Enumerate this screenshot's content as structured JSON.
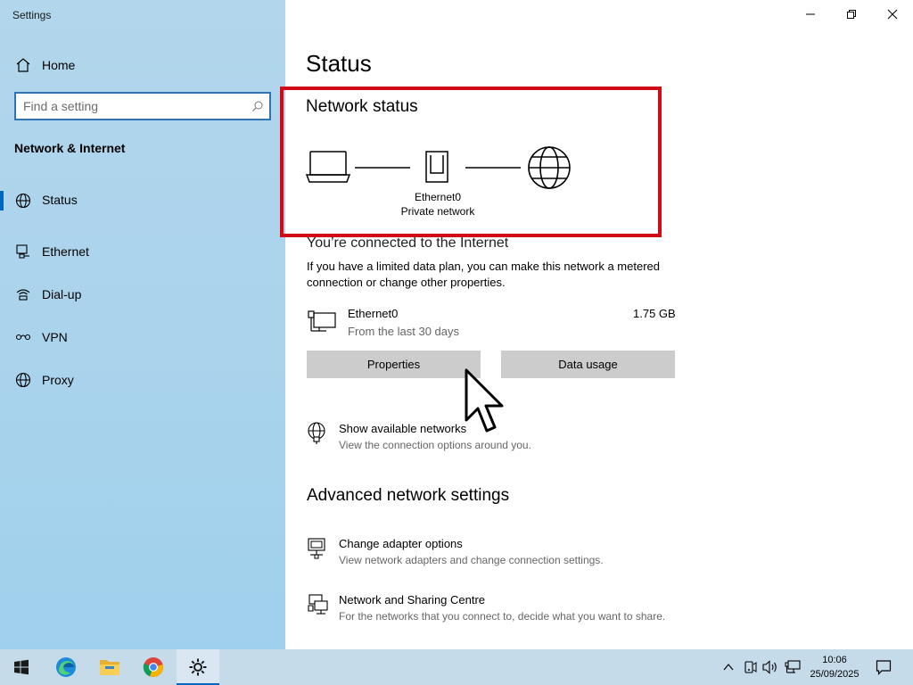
{
  "window": {
    "title": "Settings"
  },
  "sidebar": {
    "home_label": "Home",
    "search_placeholder": "Find a setting",
    "section_title": "Network & Internet",
    "items": [
      {
        "label": "Status",
        "icon": "globe-icon",
        "active": true
      },
      {
        "label": "Ethernet",
        "icon": "ethernet-icon"
      },
      {
        "label": "Dial-up",
        "icon": "dialup-icon"
      },
      {
        "label": "VPN",
        "icon": "vpn-icon"
      },
      {
        "label": "Proxy",
        "icon": "proxy-globe-icon"
      }
    ]
  },
  "main": {
    "title": "Status",
    "network_status": {
      "title": "Network status",
      "adapter_name": "Ethernet0",
      "network_type": "Private network",
      "highlight_color": "#d10a17"
    },
    "connection": {
      "title": "You’re connected to the Internet",
      "description": "If you have a limited data plan, you can make this network a metered connection or change other properties.",
      "adapter": "Ethernet0",
      "period": "From the last 30 days",
      "usage": "1.75 GB",
      "properties_button": "Properties",
      "data_usage_button": "Data usage"
    },
    "show_networks": {
      "title": "Show available networks",
      "subtitle": "View the connection options around you."
    },
    "advanced": {
      "title": "Advanced network settings",
      "adapter_options": {
        "title": "Change adapter options",
        "subtitle": "View network adapters and change connection settings."
      },
      "sharing_centre": {
        "title": "Network and Sharing Centre",
        "subtitle": "For the networks that you connect to, decide what you want to share."
      }
    }
  },
  "taskbar": {
    "apps": [
      "start-icon",
      "edge-icon",
      "file-explorer-icon",
      "chrome-icon",
      "settings-icon"
    ],
    "time": "10:06",
    "date": "25/09/2025"
  },
  "colors": {
    "accent": "#0067c0",
    "sidebar_bg": "#a9d3ec",
    "taskbar_bg": "#c5dbe9",
    "button_bg": "#cccccc"
  }
}
